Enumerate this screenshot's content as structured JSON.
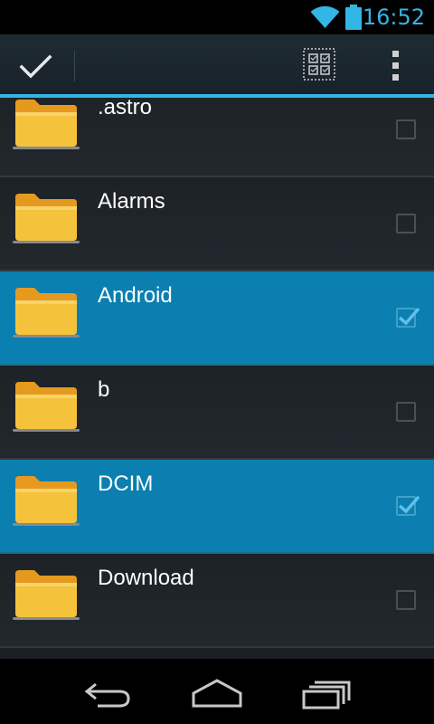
{
  "status_bar": {
    "time": "16:52",
    "icons": [
      "wifi-icon",
      "battery-icon"
    ]
  },
  "action_bar": {
    "done_icon": "checkmark-icon",
    "select_all_icon": "select-all-icon",
    "overflow_icon": "overflow-menu-icon"
  },
  "colors": {
    "accent": "#33b5e5",
    "selected_row": "#0a7fb0",
    "folder": "#f5c23c"
  },
  "files": [
    {
      "name": ".astro",
      "selected": false
    },
    {
      "name": "Alarms",
      "selected": false
    },
    {
      "name": "Android",
      "selected": true
    },
    {
      "name": "b",
      "selected": false
    },
    {
      "name": "DCIM",
      "selected": true
    },
    {
      "name": "Download",
      "selected": false
    }
  ],
  "nav_bar": {
    "icons": [
      "back-icon",
      "home-icon",
      "recents-icon"
    ]
  }
}
